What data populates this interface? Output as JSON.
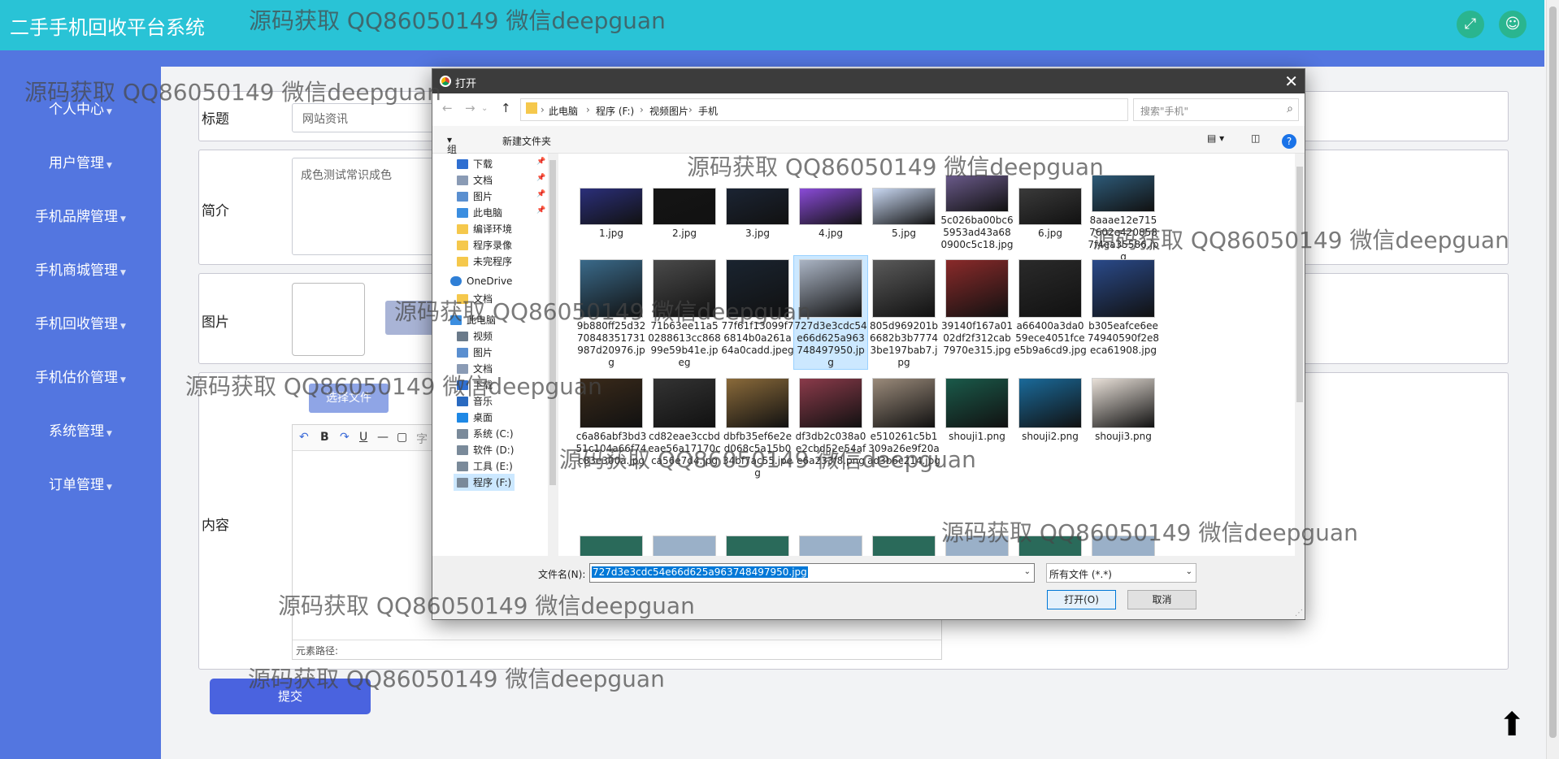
{
  "app": {
    "title": "二手手机回收平台系统"
  },
  "watermark": "源码获取 QQ86050149 微信deepguan",
  "sidebar": {
    "items": [
      {
        "label": "个人中心"
      },
      {
        "label": "用户管理"
      },
      {
        "label": "手机品牌管理"
      },
      {
        "label": "手机商城管理"
      },
      {
        "label": "手机回收管理"
      },
      {
        "label": "手机估价管理"
      },
      {
        "label": "系统管理"
      },
      {
        "label": "订单管理"
      }
    ]
  },
  "form": {
    "title_label": "标题",
    "title_value": "网站资讯",
    "intro_label": "简介",
    "intro_value": "成色测试常识成色",
    "image_label": "图片",
    "select_file": "选择文件",
    "content_label": "内容",
    "element_path": "元素路径:",
    "submit": "提交",
    "toolbar_font": "字"
  },
  "dialog": {
    "title": "打开",
    "path": [
      "此电脑",
      "程序 (F:)",
      "视频图片",
      "手机"
    ],
    "search_placeholder": "搜索\"手机\"",
    "organize": "组织",
    "new_folder": "新建文件夹",
    "nav_items": [
      "下载",
      "文档",
      "图片",
      "此电脑",
      "编译环境",
      "程序录像",
      "未完程序",
      "OneDrive",
      "文档",
      "此电脑",
      "视频",
      "图片",
      "文档",
      "下载",
      "音乐",
      "桌面",
      "系统 (C:)",
      "软件 (D:)",
      "工具 (E:)",
      "程序 (F:)"
    ],
    "files": [
      {
        "name": "1.jpg",
        "color": "#2b2f7a"
      },
      {
        "name": "2.jpg",
        "color": "#151515"
      },
      {
        "name": "3.jpg",
        "color": "#1b2433"
      },
      {
        "name": "4.jpg",
        "color": "#8a4bd8"
      },
      {
        "name": "5.jpg",
        "color": "#c9d8f2"
      },
      {
        "name": "5c026ba00bc65953ad43a680900c5c18.jpg",
        "color": "#6a5a8a"
      },
      {
        "name": "6.jpg",
        "color": "#3a3a3a"
      },
      {
        "name": "8aaae12e7157602e4208587f4ea35586.jpg",
        "color": "#2d5a78"
      },
      {
        "name": "9b880ff25d3270848351731987d20976.jpg",
        "color": "#3a6a8a"
      },
      {
        "name": "71b63ee11a50288613cc86899e59b41e.jpeg",
        "color": "#4a4a4a"
      },
      {
        "name": "77f61f13099f76814b0a261a64a0cadd.jpeg",
        "color": "#1a2430"
      },
      {
        "name": "727d3e3cdc54e66d625a963748497950.jpg",
        "color": "#aab4c4"
      },
      {
        "name": "805d969201b6682b3b77743be197bab7.jpg",
        "color": "#5a5a5a"
      },
      {
        "name": "39140f167a0102df2f312cab7970e315.jpg",
        "color": "#8a2a2a"
      },
      {
        "name": "a66400a3da059ece4051fcee5b9a6cd9.jpg",
        "color": "#2a2a2a"
      },
      {
        "name": "b305eafce6ee74940590f2e8eca61908.jpg",
        "color": "#2a4a8a"
      },
      {
        "name": "c6a86abf3bd351c104a66f74c83e300a.jpg",
        "color": "#3a2a1a"
      },
      {
        "name": "cd82eae3ccbdeae56a17170cca56e7d4.jpg",
        "color": "#333333"
      },
      {
        "name": "dbfb35ef6e2ed068c5a15b034bf7ac55.jpeg",
        "color": "#8a6a3a"
      },
      {
        "name": "df3db2c038a0e2cbd52e54afe6a233f8.png",
        "color": "#8a3a4a"
      },
      {
        "name": "e510261c5b1309a26e9f20aad3b6c214.jpg",
        "color": "#9a8a7a"
      },
      {
        "name": "shouji1.png",
        "color": "#1a5a4a"
      },
      {
        "name": "shouji2.png",
        "color": "#1a6a9a"
      },
      {
        "name": "shouji3.png",
        "color": "#e8e0d8"
      }
    ],
    "filename_label": "文件名(N):",
    "filename_value": "727d3e3cdc54e66d625a963748497950.jpg",
    "filetype": "所有文件 (*.*)",
    "open": "打开(O)",
    "cancel": "取消"
  }
}
